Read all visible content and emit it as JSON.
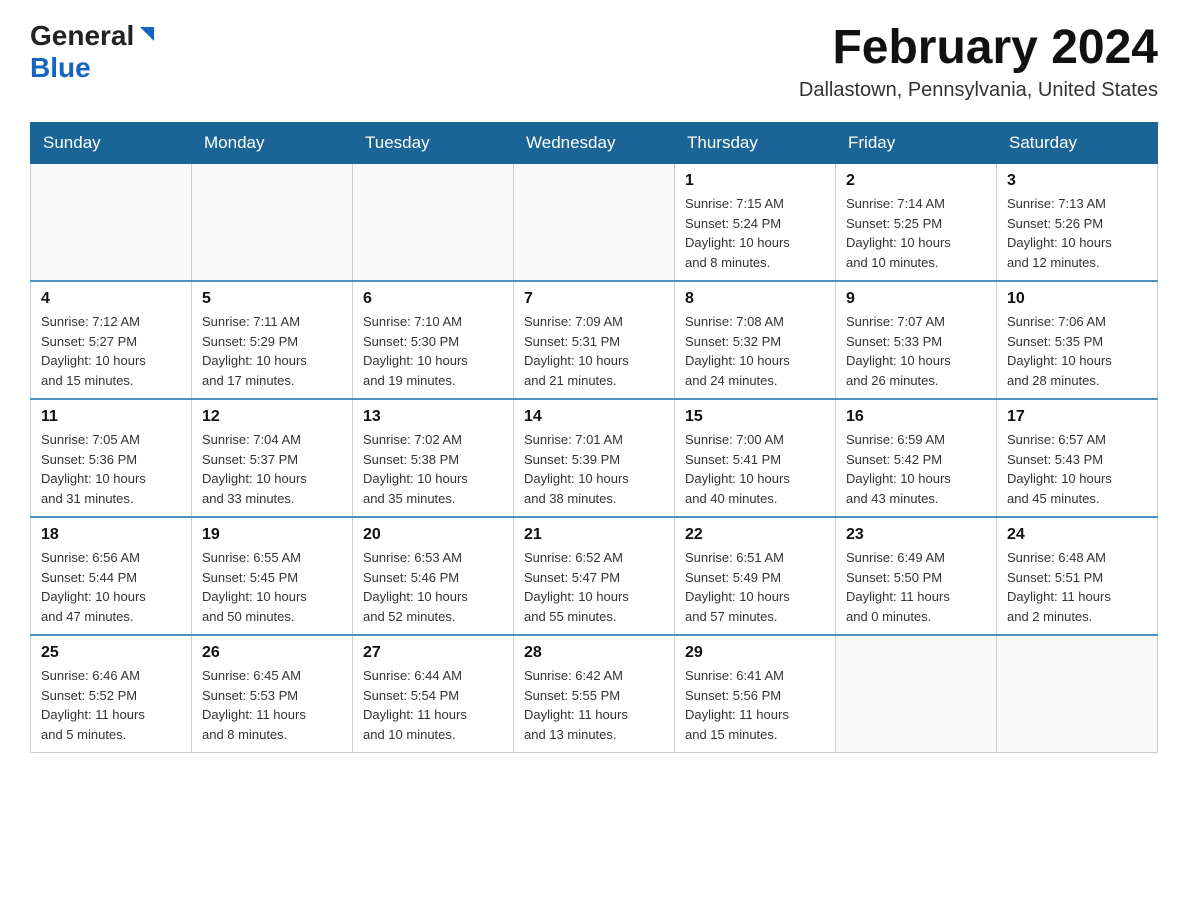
{
  "header": {
    "logo_general": "General",
    "logo_blue": "Blue",
    "month_title": "February 2024",
    "location": "Dallastown, Pennsylvania, United States"
  },
  "days_of_week": [
    "Sunday",
    "Monday",
    "Tuesday",
    "Wednesday",
    "Thursday",
    "Friday",
    "Saturday"
  ],
  "weeks": [
    [
      {
        "day": "",
        "info": ""
      },
      {
        "day": "",
        "info": ""
      },
      {
        "day": "",
        "info": ""
      },
      {
        "day": "",
        "info": ""
      },
      {
        "day": "1",
        "info": "Sunrise: 7:15 AM\nSunset: 5:24 PM\nDaylight: 10 hours\nand 8 minutes."
      },
      {
        "day": "2",
        "info": "Sunrise: 7:14 AM\nSunset: 5:25 PM\nDaylight: 10 hours\nand 10 minutes."
      },
      {
        "day": "3",
        "info": "Sunrise: 7:13 AM\nSunset: 5:26 PM\nDaylight: 10 hours\nand 12 minutes."
      }
    ],
    [
      {
        "day": "4",
        "info": "Sunrise: 7:12 AM\nSunset: 5:27 PM\nDaylight: 10 hours\nand 15 minutes."
      },
      {
        "day": "5",
        "info": "Sunrise: 7:11 AM\nSunset: 5:29 PM\nDaylight: 10 hours\nand 17 minutes."
      },
      {
        "day": "6",
        "info": "Sunrise: 7:10 AM\nSunset: 5:30 PM\nDaylight: 10 hours\nand 19 minutes."
      },
      {
        "day": "7",
        "info": "Sunrise: 7:09 AM\nSunset: 5:31 PM\nDaylight: 10 hours\nand 21 minutes."
      },
      {
        "day": "8",
        "info": "Sunrise: 7:08 AM\nSunset: 5:32 PM\nDaylight: 10 hours\nand 24 minutes."
      },
      {
        "day": "9",
        "info": "Sunrise: 7:07 AM\nSunset: 5:33 PM\nDaylight: 10 hours\nand 26 minutes."
      },
      {
        "day": "10",
        "info": "Sunrise: 7:06 AM\nSunset: 5:35 PM\nDaylight: 10 hours\nand 28 minutes."
      }
    ],
    [
      {
        "day": "11",
        "info": "Sunrise: 7:05 AM\nSunset: 5:36 PM\nDaylight: 10 hours\nand 31 minutes."
      },
      {
        "day": "12",
        "info": "Sunrise: 7:04 AM\nSunset: 5:37 PM\nDaylight: 10 hours\nand 33 minutes."
      },
      {
        "day": "13",
        "info": "Sunrise: 7:02 AM\nSunset: 5:38 PM\nDaylight: 10 hours\nand 35 minutes."
      },
      {
        "day": "14",
        "info": "Sunrise: 7:01 AM\nSunset: 5:39 PM\nDaylight: 10 hours\nand 38 minutes."
      },
      {
        "day": "15",
        "info": "Sunrise: 7:00 AM\nSunset: 5:41 PM\nDaylight: 10 hours\nand 40 minutes."
      },
      {
        "day": "16",
        "info": "Sunrise: 6:59 AM\nSunset: 5:42 PM\nDaylight: 10 hours\nand 43 minutes."
      },
      {
        "day": "17",
        "info": "Sunrise: 6:57 AM\nSunset: 5:43 PM\nDaylight: 10 hours\nand 45 minutes."
      }
    ],
    [
      {
        "day": "18",
        "info": "Sunrise: 6:56 AM\nSunset: 5:44 PM\nDaylight: 10 hours\nand 47 minutes."
      },
      {
        "day": "19",
        "info": "Sunrise: 6:55 AM\nSunset: 5:45 PM\nDaylight: 10 hours\nand 50 minutes."
      },
      {
        "day": "20",
        "info": "Sunrise: 6:53 AM\nSunset: 5:46 PM\nDaylight: 10 hours\nand 52 minutes."
      },
      {
        "day": "21",
        "info": "Sunrise: 6:52 AM\nSunset: 5:47 PM\nDaylight: 10 hours\nand 55 minutes."
      },
      {
        "day": "22",
        "info": "Sunrise: 6:51 AM\nSunset: 5:49 PM\nDaylight: 10 hours\nand 57 minutes."
      },
      {
        "day": "23",
        "info": "Sunrise: 6:49 AM\nSunset: 5:50 PM\nDaylight: 11 hours\nand 0 minutes."
      },
      {
        "day": "24",
        "info": "Sunrise: 6:48 AM\nSunset: 5:51 PM\nDaylight: 11 hours\nand 2 minutes."
      }
    ],
    [
      {
        "day": "25",
        "info": "Sunrise: 6:46 AM\nSunset: 5:52 PM\nDaylight: 11 hours\nand 5 minutes."
      },
      {
        "day": "26",
        "info": "Sunrise: 6:45 AM\nSunset: 5:53 PM\nDaylight: 11 hours\nand 8 minutes."
      },
      {
        "day": "27",
        "info": "Sunrise: 6:44 AM\nSunset: 5:54 PM\nDaylight: 11 hours\nand 10 minutes."
      },
      {
        "day": "28",
        "info": "Sunrise: 6:42 AM\nSunset: 5:55 PM\nDaylight: 11 hours\nand 13 minutes."
      },
      {
        "day": "29",
        "info": "Sunrise: 6:41 AM\nSunset: 5:56 PM\nDaylight: 11 hours\nand 15 minutes."
      },
      {
        "day": "",
        "info": ""
      },
      {
        "day": "",
        "info": ""
      }
    ]
  ]
}
